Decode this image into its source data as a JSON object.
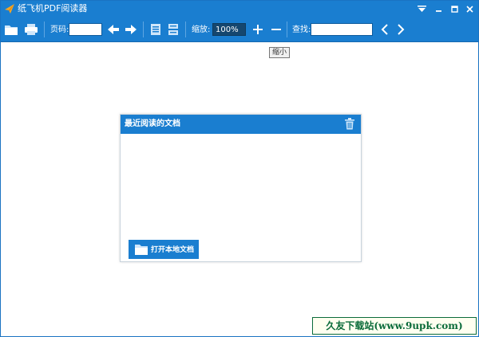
{
  "window": {
    "title": "纸飞机PDF阅读器"
  },
  "toolbar": {
    "page_label": "页码:",
    "page_value": "",
    "zoom_label": "缩放:",
    "zoom_value": "100%",
    "search_label": "查找:",
    "search_value": ""
  },
  "tooltip": {
    "text": "缩小"
  },
  "recent_panel": {
    "title": "最近阅读的文档",
    "open_button_label": "打开本地文档"
  },
  "watermark": {
    "text": "久友下载站(www.9upk.com)"
  },
  "colors": {
    "accent": "#1a7ed0",
    "toolbar_dark": "#15476f",
    "watermark_green": "#0b6b3a"
  },
  "icons": [
    "app-plane-icon",
    "open-folder-icon",
    "print-icon",
    "prev-page-icon",
    "next-page-icon",
    "single-page-icon",
    "double-page-icon",
    "zoom-in-icon",
    "zoom-out-icon",
    "search-prev-icon",
    "search-next-icon",
    "trash-icon",
    "folder-icon",
    "minimize-icon",
    "maximize-icon",
    "close-icon",
    "menu-dropdown-icon"
  ]
}
